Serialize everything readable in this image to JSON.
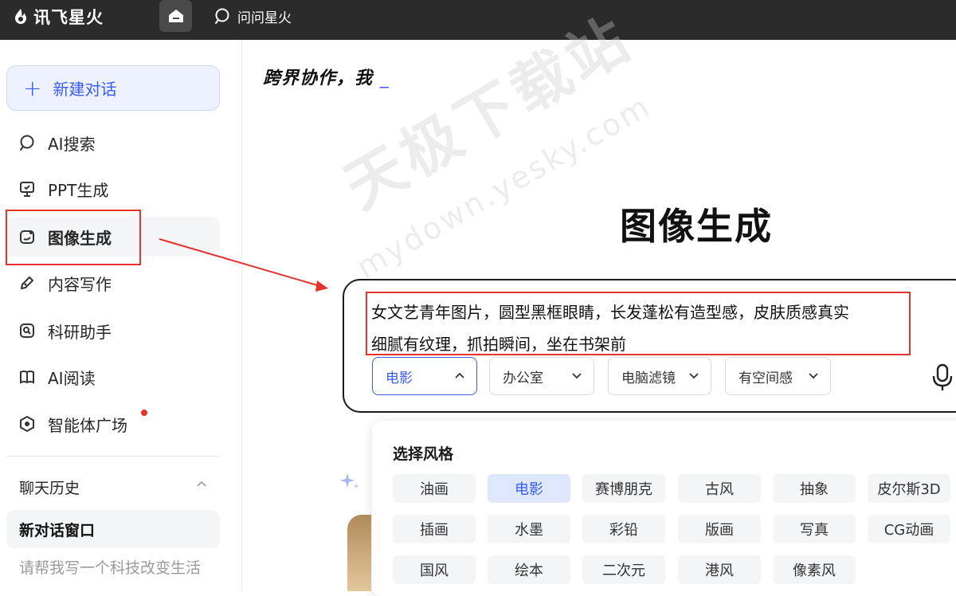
{
  "topbar": {
    "logo_text": "讯飞星火",
    "home_icon": "home-icon",
    "ask_label": "问问星火"
  },
  "sidebar": {
    "new_chat_label": "新建对话",
    "items": [
      {
        "label": "AI搜索",
        "icon": "search-chat-icon"
      },
      {
        "label": "PPT生成",
        "icon": "presentation-icon"
      },
      {
        "label": "图像生成",
        "icon": "image-sparkle-icon",
        "active": true
      },
      {
        "label": "内容写作",
        "icon": "pen-icon"
      },
      {
        "label": "科研助手",
        "icon": "research-icon"
      },
      {
        "label": "AI阅读",
        "icon": "book-icon"
      },
      {
        "label": "智能体广场",
        "icon": "agent-icon",
        "badge": "dot"
      }
    ],
    "history_title": "聊天历史",
    "history": [
      {
        "label": "新对话窗口"
      },
      {
        "label": "请帮我写一个科技改变生活"
      }
    ]
  },
  "main": {
    "tagline": "跨界协作，我",
    "cursor": "_",
    "heading": "图像生成",
    "watermark_main": "天极下载站",
    "watermark_url": "mydown.yesky.com",
    "prompt_line1": "女文艺青年图片，圆型黑框眼睛，长发蓬松有造型感，皮肤质感真实",
    "prompt_line2": "细腻有纹理，抓拍瞬间，坐在书架前",
    "chips": [
      "电影",
      "办公室",
      "电脑滤镜",
      "有空间感"
    ],
    "dropdown_title": "选择风格",
    "styles": [
      [
        "油画",
        "电影",
        "赛博朋克",
        "古风",
        "抽象",
        "皮尔斯3D"
      ],
      [
        "插画",
        "水墨",
        "彩铅",
        "版画",
        "写真",
        "CG动画"
      ],
      [
        "国风",
        "绘本",
        "二次元",
        "港风",
        "像素风"
      ]
    ],
    "selected_style": "电影"
  },
  "colors": {
    "accent": "#3a5cf5",
    "topbar": "#2b2b2b",
    "annotation_red": "#e5322d"
  }
}
